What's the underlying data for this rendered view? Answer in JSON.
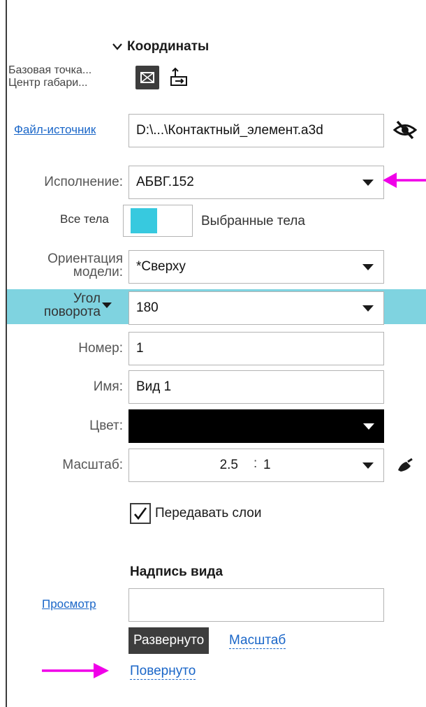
{
  "section": {
    "title": "Координаты"
  },
  "base_point": {
    "line1": "Базовая точка...",
    "line2": "Центр габари..."
  },
  "source": {
    "link_label": "Файл-источник",
    "value": "D:\\...\\Контактный_элемент.a3d"
  },
  "execution": {
    "label": "Исполнение:",
    "value": "АБВГ.152"
  },
  "bodies": {
    "left_label": "Все тела",
    "right_label": "Выбранные тела"
  },
  "orientation": {
    "label_line1": "Ориентация",
    "label_line2": "модели:",
    "value": "*Сверху"
  },
  "rotation": {
    "label_line1": "Угол",
    "label_line2": "поворота",
    "value": "180"
  },
  "number": {
    "label": "Номер:",
    "value": "1"
  },
  "name": {
    "label": "Имя:",
    "value": "Вид 1"
  },
  "color": {
    "label": "Цвет:",
    "swatch": "#000000"
  },
  "scale": {
    "label": "Масштаб:",
    "numerator": "2.5",
    "separator": ":",
    "denominator": "1"
  },
  "transfer_layers": {
    "label": "Передавать слои",
    "checked": true
  },
  "view_caption": {
    "title": "Надпись вида",
    "preview_link": "Просмотр",
    "preview_value": "",
    "tag_expanded": "Развернуто",
    "link_scale": "Масштаб",
    "link_rotated": "Повернуто"
  },
  "colors": {
    "accent_arrow": "#f000e8",
    "highlight": "#7fd3e0",
    "toggle": "#37c9df",
    "link": "#1a66c8"
  }
}
